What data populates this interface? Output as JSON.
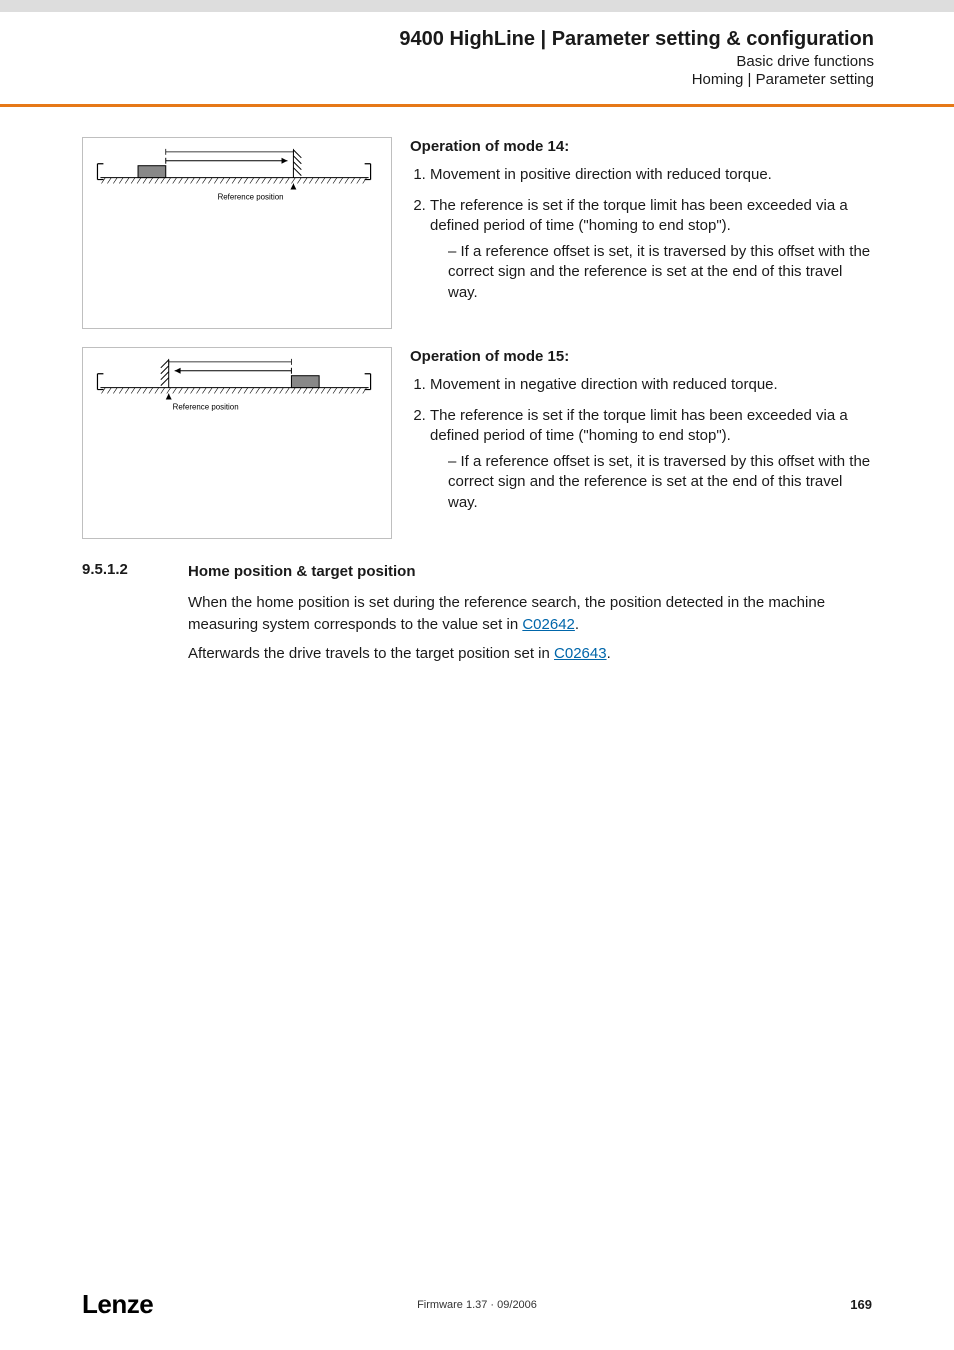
{
  "header": {
    "title": "9400 HighLine | Parameter setting & configuration",
    "sub1": "Basic drive functions",
    "sub2": "Homing | Parameter setting"
  },
  "fig14": {
    "refpos": "Reference position"
  },
  "fig15": {
    "refpos": "Reference position"
  },
  "mode14": {
    "title": "Operation of mode 14:",
    "li1": "Movement in positive direction with reduced torque.",
    "li2": "The reference is set if the torque limit has been exceeded via a defined period of time (\"homing to end stop\").",
    "sub": "If a reference offset is set, it is traversed by this offset with the correct sign and the reference is set at the end of this travel way."
  },
  "mode15": {
    "title": "Operation of mode 15:",
    "li1": "Movement in negative direction with reduced torque.",
    "li2": "The reference is set if the torque limit has been exceeded via a defined period of time (\"homing to end stop\").",
    "sub": "If a reference offset is set, it is traversed by this offset with the correct sign and the reference is set at the end of this travel way."
  },
  "section": {
    "num": "9.5.1.2",
    "heading": "Home position & target position",
    "p1a": "When the home position is set during the reference search, the position detected in the machine measuring system corresponds to the value set in ",
    "p1link": "C02642",
    "p1b": ".",
    "p2a": "Afterwards the drive travels to the target position set in ",
    "p2link": "C02643",
    "p2b": "."
  },
  "footer": {
    "logo": "Lenze",
    "fw": "Firmware 1.37 · 09/2006",
    "page": "169"
  }
}
